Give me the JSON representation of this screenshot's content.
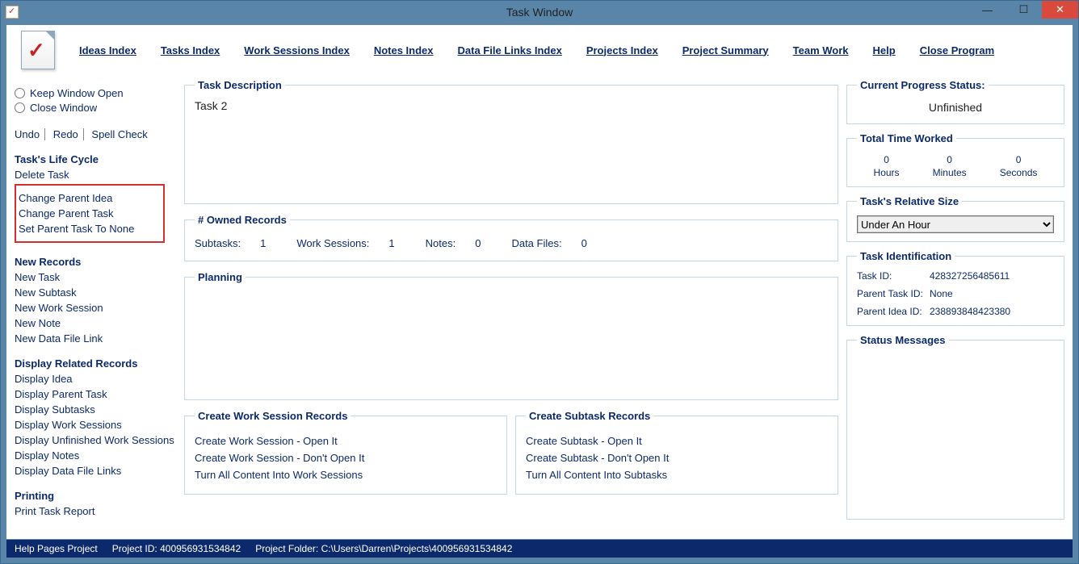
{
  "window": {
    "title": "Task Window"
  },
  "menubar": {
    "items": [
      {
        "label": "Ideas Index"
      },
      {
        "label": "Tasks Index"
      },
      {
        "label": "Work Sessions Index"
      },
      {
        "label": "Notes Index"
      },
      {
        "label": "Data File Links Index"
      },
      {
        "label": "Projects Index"
      },
      {
        "label": "Project Summary"
      },
      {
        "label": "Team Work"
      },
      {
        "label": "Help"
      },
      {
        "label": "Close Program"
      }
    ]
  },
  "sidebar": {
    "keep_open": "Keep Window Open",
    "close_window": "Close Window",
    "undo": "Undo",
    "redo": "Redo",
    "spellcheck": "Spell Check",
    "sections": {
      "lifecycle": {
        "title": "Task's Life Cycle",
        "links": [
          "Delete Task"
        ],
        "boxed": [
          "Change Parent Idea",
          "Change Parent Task",
          "Set Parent Task To None"
        ]
      },
      "newrecords": {
        "title": "New Records",
        "links": [
          "New Task",
          "New Subtask",
          "New Work Session",
          "New Note",
          "New Data File Link"
        ]
      },
      "display": {
        "title": "Display Related Records",
        "links": [
          "Display Idea",
          "Display Parent Task",
          "Display Subtasks",
          "Display Work Sessions",
          "Display Unfinished Work Sessions",
          "Display Notes",
          "Display Data File Links"
        ]
      },
      "printing": {
        "title": "Printing",
        "links": [
          "Print Task Report"
        ]
      }
    }
  },
  "center": {
    "desc_legend": "Task Description",
    "desc_text": "Task 2",
    "owned_legend": "# Owned Records",
    "owned": {
      "subtasks_label": "Subtasks:",
      "subtasks": "1",
      "worksessions_label": "Work Sessions:",
      "worksessions": "1",
      "notes_label": "Notes:",
      "notes": "0",
      "datafiles_label": "Data Files:",
      "datafiles": "0"
    },
    "planning_legend": "Planning",
    "cws": {
      "legend": "Create Work Session Records",
      "links": [
        "Create Work Session - Open It",
        "Create Work Session - Don't Open It",
        "Turn All Content Into Work Sessions"
      ]
    },
    "cst": {
      "legend": "Create Subtask Records",
      "links": [
        "Create Subtask - Open It",
        "Create Subtask - Don't Open It",
        "Turn All Content Into Subtasks"
      ]
    }
  },
  "right": {
    "status_legend": "Current Progress Status:",
    "status_value": "Unfinished",
    "time_legend": "Total Time Worked",
    "hours": "0",
    "hours_lbl": "Hours",
    "minutes": "0",
    "minutes_lbl": "Minutes",
    "seconds": "0",
    "seconds_lbl": "Seconds",
    "size_legend": "Task's Relative Size",
    "size_value": "Under An Hour",
    "ident_legend": "Task Identification",
    "taskid_lbl": "Task ID:",
    "taskid": "428327256485611",
    "ptaskid_lbl": "Parent Task ID:",
    "ptaskid": "None",
    "pideaid_lbl": "Parent Idea ID:",
    "pideaid": "238893848423380",
    "msgs_legend": "Status Messages"
  },
  "statusbar": {
    "help": "Help Pages Project",
    "projid_lbl": "Project ID:",
    "projid": "400956931534842",
    "projfolder_lbl": "Project Folder:",
    "projfolder": "C:\\Users\\Darren\\Projects\\400956931534842"
  }
}
